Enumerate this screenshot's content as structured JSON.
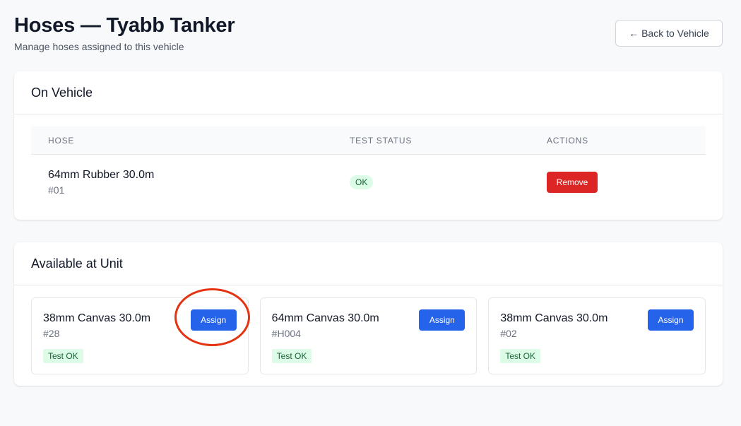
{
  "header": {
    "title": "Hoses — Tyabb Tanker",
    "subtitle": "Manage hoses assigned to this vehicle",
    "back_label": "← Back to Vehicle"
  },
  "on_vehicle": {
    "title": "On Vehicle",
    "columns": [
      "Hose",
      "Test Status",
      "Actions"
    ],
    "rows": [
      {
        "name": "64mm Rubber 30.0m",
        "id": "#01",
        "status": "OK",
        "action": "Remove"
      }
    ]
  },
  "available": {
    "title": "Available at Unit",
    "hoses": [
      {
        "name": "38mm Canvas 30.0m",
        "id": "#28",
        "badge": "Test OK",
        "action": "Assign"
      },
      {
        "name": "64mm Canvas 30.0m",
        "id": "#H004",
        "badge": "Test OK",
        "action": "Assign"
      },
      {
        "name": "38mm Canvas 30.0m",
        "id": "#02",
        "badge": "Test OK",
        "action": "Assign"
      }
    ]
  },
  "colors": {
    "primary": "#2563eb",
    "danger": "#dc2626",
    "success_bg": "#dcfce7",
    "success_text": "#166534",
    "annotation": "#e53312"
  }
}
